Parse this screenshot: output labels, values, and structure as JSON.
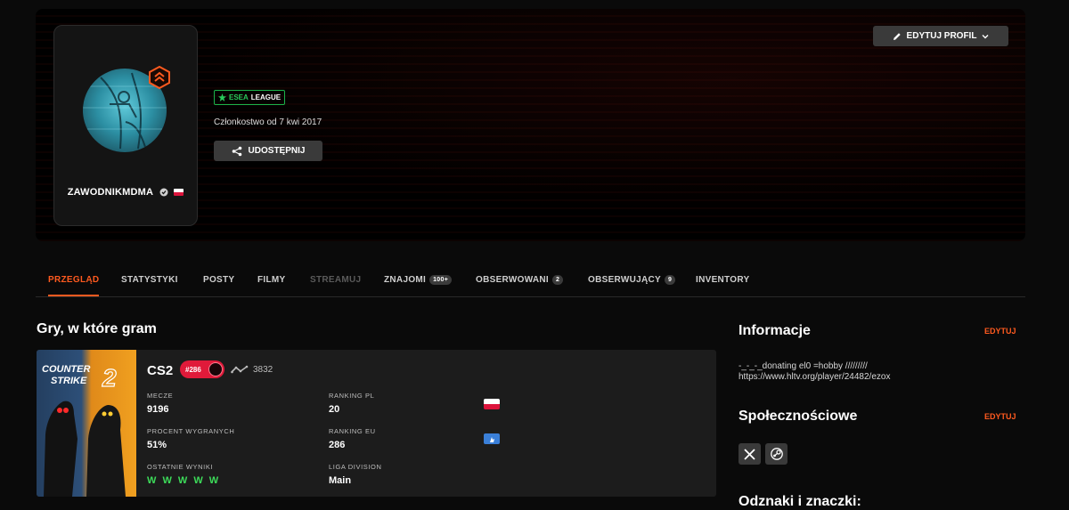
{
  "profile": {
    "username": "ZAWODNIKMDMA",
    "league_prefix": "ESEA",
    "league_suffix": "LEAGUE",
    "member_since": "Członkostwo od 7 kwi 2017",
    "share_label": "UDOSTĘPNIJ",
    "edit_profile_label": "EDYTUJ PROFIL"
  },
  "tabs": [
    {
      "label": "PRZEGLĄD",
      "state": "active"
    },
    {
      "label": "STATYSTYKI"
    },
    {
      "label": "POSTY"
    },
    {
      "label": "FILMY"
    },
    {
      "label": "STREAMUJ",
      "state": "disabled"
    },
    {
      "label": "ZNAJOMI",
      "count": "100+"
    },
    {
      "label": "OBSERWOWANI",
      "count": "2"
    },
    {
      "label": "OBSERWUJĄCY",
      "count": "9"
    },
    {
      "label": "INVENTORY"
    }
  ],
  "games_section": {
    "title": "Gry, w które gram",
    "game": {
      "cover_line1": "COUNTER",
      "cover_line2": "STRIKE",
      "cover_number": "2",
      "name": "CS2",
      "rank_badge": "#286",
      "elo": "3832",
      "stats": {
        "matches_label": "MECZE",
        "matches_value": "9196",
        "rank_pl_label": "RANKING PL",
        "rank_pl_value": "20",
        "win_pct_label": "PROCENT WYGRANYCH",
        "win_pct_value": "51%",
        "rank_eu_label": "RANKING EU",
        "rank_eu_value": "286",
        "recent_label": "OSTATNIE WYNIKI",
        "recent_value": "W W W W W",
        "division_label": "LIGA DIVISION",
        "division_value": "Main"
      }
    }
  },
  "sidebar": {
    "info_title": "Informacje",
    "info_edit": "EDYTUJ",
    "bio_line1": "-_-_-_donating el0 =hobby /////////",
    "bio_line2": "https://www.hltv.org/player/24482/ezox",
    "social_title": "Społecznościowe",
    "social_edit": "EDYTUJ",
    "badges_title": "Odznaki i znaczki:"
  },
  "colors": {
    "accent": "#ff5a1f",
    "win": "#3ddc5a",
    "esea": "#1bb34a",
    "rank_pill": "#e01a3a"
  }
}
